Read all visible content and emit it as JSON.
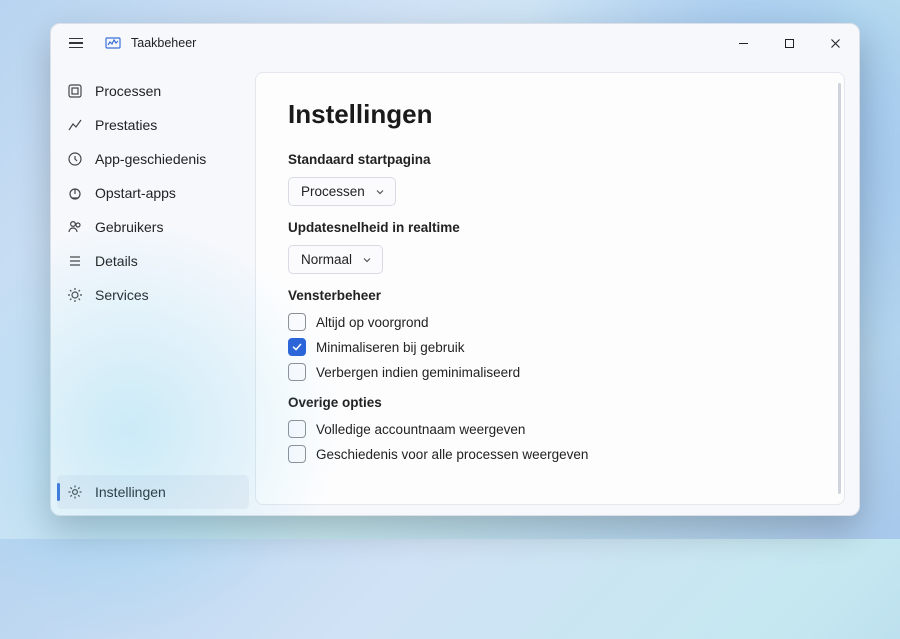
{
  "window_title": "Taakbeheer",
  "sidebar": {
    "items": [
      {
        "label": "Processen",
        "icon": "processes"
      },
      {
        "label": "Prestaties",
        "icon": "performance"
      },
      {
        "label": "App-geschiedenis",
        "icon": "history"
      },
      {
        "label": "Opstart-apps",
        "icon": "startup"
      },
      {
        "label": "Gebruikers",
        "icon": "users"
      },
      {
        "label": "Details",
        "icon": "details"
      },
      {
        "label": "Services",
        "icon": "services"
      }
    ],
    "bottom_item": {
      "label": "Instellingen",
      "icon": "settings"
    }
  },
  "page": {
    "title": "Instellingen",
    "default_startpage": {
      "label": "Standaard startpagina",
      "value": "Processen"
    },
    "update_speed": {
      "label": "Updatesnelheid in realtime",
      "value": "Normaal"
    },
    "window_mgmt": {
      "label": "Vensterbeheer",
      "options": [
        {
          "label": "Altijd op voorgrond",
          "checked": false
        },
        {
          "label": "Minimaliseren bij gebruik",
          "checked": true
        },
        {
          "label": "Verbergen indien geminimaliseerd",
          "checked": false
        }
      ]
    },
    "other": {
      "label": "Overige opties",
      "options": [
        {
          "label": "Volledige accountnaam weergeven",
          "checked": false
        },
        {
          "label": "Geschiedenis voor alle processen weergeven",
          "checked": false
        }
      ]
    }
  }
}
